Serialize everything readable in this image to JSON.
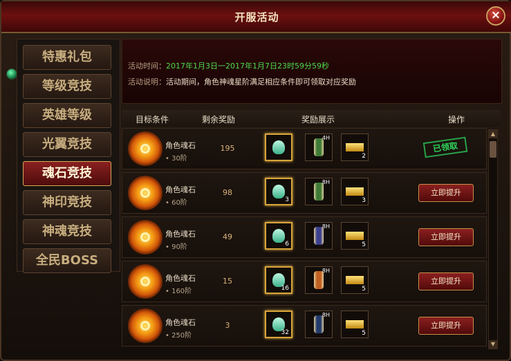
{
  "window": {
    "title": "开服活动",
    "close_label": "×"
  },
  "sidebar": {
    "items": [
      {
        "label": "特惠礼包",
        "active": false
      },
      {
        "label": "等级竞技",
        "active": false
      },
      {
        "label": "英雄等级",
        "active": false
      },
      {
        "label": "光翼竞技",
        "active": false
      },
      {
        "label": "魂石竞技",
        "active": true
      },
      {
        "label": "神印竞技",
        "active": false
      },
      {
        "label": "神魂竞技",
        "active": false
      },
      {
        "label": "全民BOSS",
        "active": false
      }
    ]
  },
  "info": {
    "time_label": "活动时间：",
    "time_value": "2017年1月3日一2017年1月7日23时59分59秒",
    "desc_label": "活动说明：",
    "desc_value": "活动期间，角色神魂星阶满足相应条件即可领取对应奖励"
  },
  "table": {
    "headers": {
      "target": "目标条件",
      "remaining": "剩余奖励",
      "display": "奖励展示",
      "action": "操作"
    },
    "rows": [
      {
        "name": "角色魂石",
        "stage": "• 30阶",
        "remaining": "195",
        "gem_count": "",
        "scroll_hours": "4H",
        "scroll_color": "#3e7a36",
        "gold_count": "2",
        "action": "claimed",
        "action_label": "已领取"
      },
      {
        "name": "角色魂石",
        "stage": "• 60阶",
        "remaining": "98",
        "gem_count": "3",
        "scroll_hours": "8H",
        "scroll_color": "#3e7a36",
        "gold_count": "3",
        "action": "button",
        "action_label": "立即提升"
      },
      {
        "name": "角色魂石",
        "stage": "• 90阶",
        "remaining": "49",
        "gem_count": "6",
        "scroll_hours": "8H",
        "scroll_color": "#3b3f8c",
        "gold_count": "5",
        "action": "button",
        "action_label": "立即提升"
      },
      {
        "name": "角色魂石",
        "stage": "• 160阶",
        "remaining": "15",
        "gem_count": "16",
        "scroll_hours": "8H",
        "scroll_color": "#c06020",
        "gold_count": "5",
        "action": "button",
        "action_label": "立即提升"
      },
      {
        "name": "角色魂石",
        "stage": "• 250阶",
        "remaining": "3",
        "gem_count": "32",
        "scroll_hours": "8H",
        "scroll_color": "#223a6a",
        "gold_count": "5",
        "action": "button",
        "action_label": "立即提升"
      }
    ]
  },
  "scrollbar": {
    "up": "▲",
    "down": "▼"
  }
}
